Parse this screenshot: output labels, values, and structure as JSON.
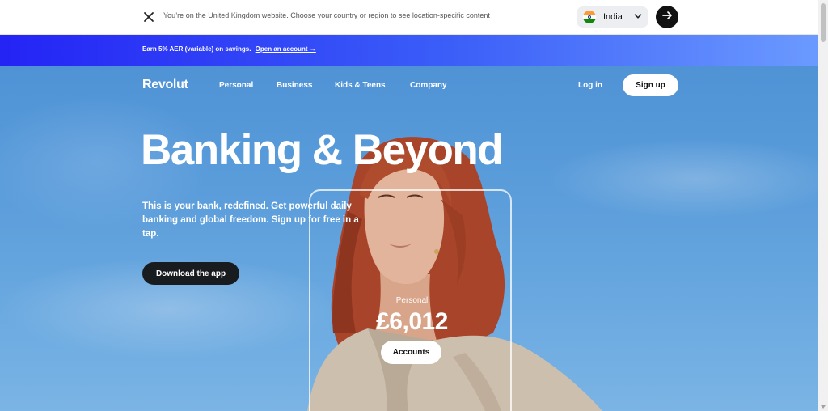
{
  "country_bar": {
    "message": "You’re on the United Kingdom website. Choose your country or region to see location-specific content",
    "selected_country": "India",
    "close_icon": "close-icon",
    "go_icon": "arrow-right-icon"
  },
  "promo": {
    "text": "Earn 5% AER (variable) on savings.",
    "link": "Open an account →"
  },
  "nav": {
    "logo": "Revolut",
    "items": [
      "Personal",
      "Business",
      "Kids & Teens",
      "Company"
    ],
    "login": "Log in",
    "signup": "Sign up"
  },
  "hero": {
    "headline": "Banking & Beyond",
    "subtext": "This is your bank, redefined. Get powerful daily banking and global freedom. Sign up for free in a tap.",
    "cta": "Download the app",
    "card": {
      "label": "Personal",
      "amount": "£6,012",
      "button": "Accounts"
    }
  },
  "colors": {
    "promo_start": "#2424f5",
    "promo_end": "#6b9aff",
    "sky": "#5c9edb",
    "dark_button": "#191c1f"
  }
}
